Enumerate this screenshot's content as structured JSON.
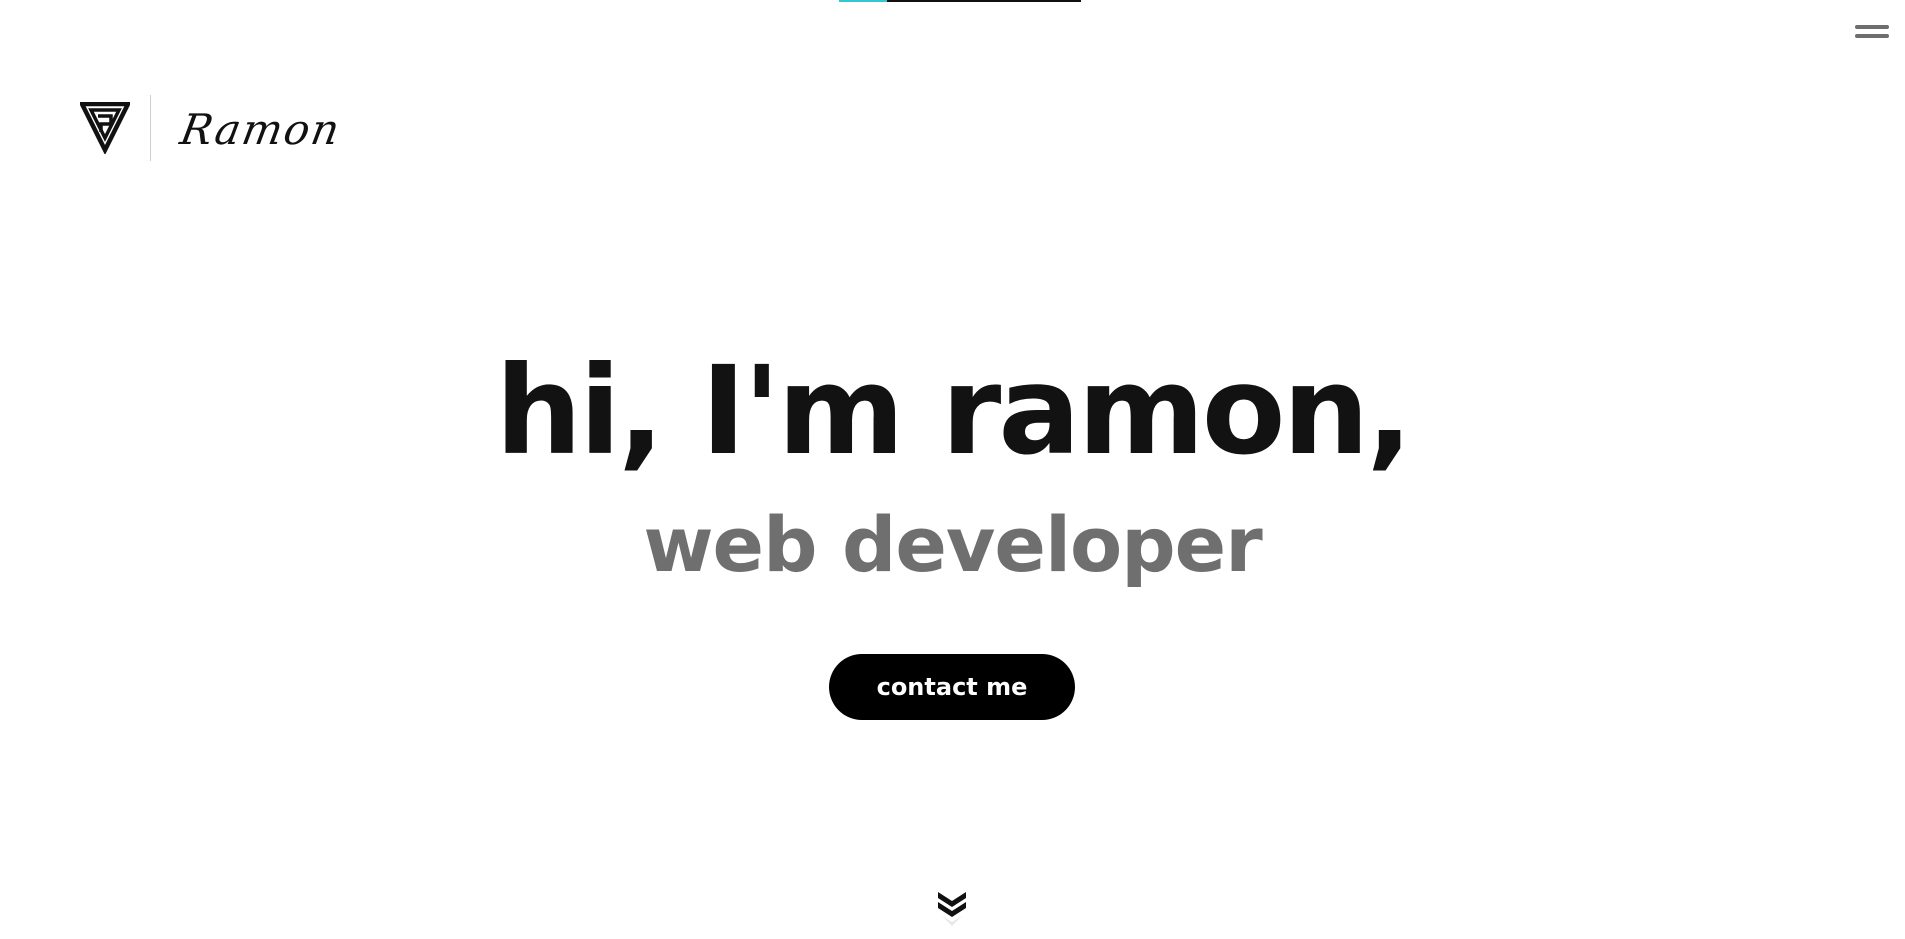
{
  "progress": {
    "value_fraction": 0.2,
    "track_color": "#111111",
    "fill_color": "#34c6d3"
  },
  "header": {
    "menu_icon": "hamburger-menu-icon",
    "logo": {
      "mark_icon": "triangle-monogram-icon",
      "script_text": "Ramon"
    }
  },
  "hero": {
    "title": "hi, I'm ramon,",
    "subtitle": "web developer",
    "cta_label": "contact me"
  },
  "scroll_indicator": {
    "icon": "double-chevron-down-icon"
  },
  "colors": {
    "title": "#121212",
    "subtitle": "#6f6f6f",
    "button_bg": "#000000",
    "button_text": "#ffffff"
  }
}
